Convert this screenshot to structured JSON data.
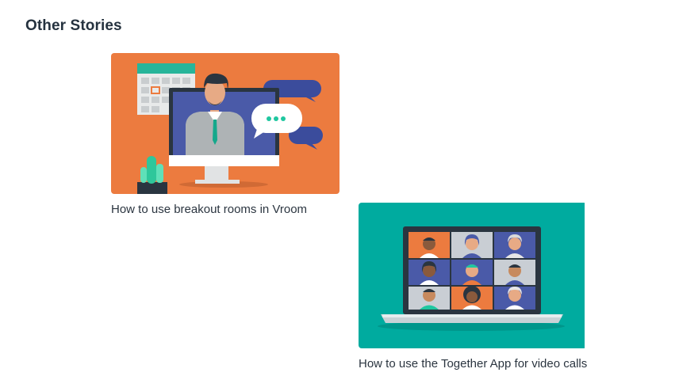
{
  "section": {
    "title": "Other Stories"
  },
  "stories": [
    {
      "title": "How to use breakout rooms in Vroom",
      "image": "video-conference-illustration",
      "background": "#ec7b3f"
    },
    {
      "title": "How to use the Together App for video calls",
      "image": "laptop-video-grid-illustration",
      "background": "#00ab9f"
    }
  ],
  "colors": {
    "heading": "#25323f",
    "caption": "#2b3540",
    "orange": "#ec7b3f",
    "teal": "#00ab9f",
    "navy": "#3b4c9c",
    "green": "#1fc7a0"
  }
}
